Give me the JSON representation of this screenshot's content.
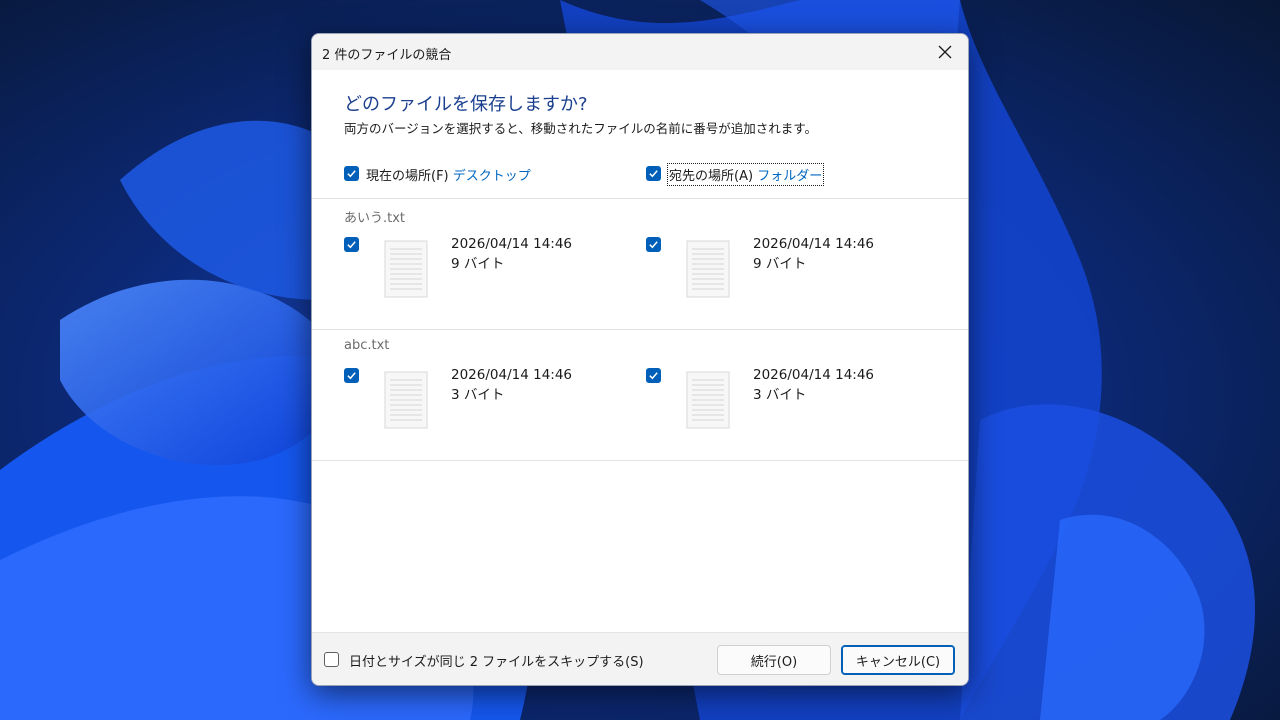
{
  "dialog": {
    "title": "2 件のファイルの競合",
    "heading": "どのファイルを保存しますか?",
    "description": "両方のバージョンを選択すると、移動されたファイルの名前に番号が追加されます。"
  },
  "columns": {
    "source": {
      "label": "現在の場所(F)",
      "location": "デスクトップ",
      "checked": true
    },
    "destination": {
      "label": "宛先の場所(A)",
      "location": "フォルダー",
      "checked": true
    }
  },
  "files": [
    {
      "name": "あいう.txt",
      "source": {
        "date": "2026/04/14 14:46",
        "size": "9 バイト",
        "checked": true
      },
      "destination": {
        "date": "2026/04/14 14:46",
        "size": "9 バイト",
        "checked": true
      }
    },
    {
      "name": "abc.txt",
      "source": {
        "date": "2026/04/14 14:46",
        "size": "3 バイト",
        "checked": true
      },
      "destination": {
        "date": "2026/04/14 14:46",
        "size": "3 バイト",
        "checked": true
      }
    }
  ],
  "footer": {
    "skip_label": "日付とサイズが同じ 2 ファイルをスキップする(S)",
    "skip_checked": false,
    "continue_label": "続行(O)",
    "cancel_label": "キャンセル(C)"
  },
  "icons": {
    "close": "close-icon",
    "check": "check-icon",
    "file": "text-file-icon"
  },
  "colors": {
    "accent": "#005fb8",
    "heading": "#1a3f8f",
    "link": "#0067c0"
  }
}
